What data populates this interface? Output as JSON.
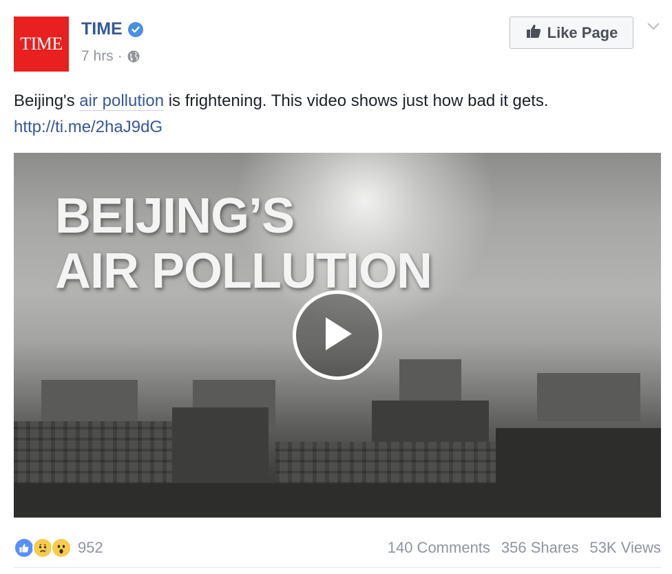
{
  "post": {
    "page_name": "TIME",
    "avatar_text": "TIME",
    "time_ago": "7 hrs",
    "separator": "·",
    "like_button_label": "Like Page",
    "caption": {
      "prefix": "Beijing's ",
      "link_text": "air pollution",
      "suffix": " is frightening. This video shows just how bad it gets.",
      "url": "http://ti.me/2haJ9dG"
    },
    "video": {
      "title_line1": "BEIJING’S",
      "title_line2": "AIR POLLUTION"
    },
    "footer": {
      "reaction_count": "952",
      "comments": "140 Comments",
      "shares": "356 Shares",
      "views": "53K Views"
    }
  },
  "icons": [
    "verified-badge-icon",
    "globe-icon",
    "thumbs-up-icon",
    "chevron-down-icon",
    "play-icon",
    "like-reaction-icon",
    "sad-reaction-icon",
    "wow-reaction-icon"
  ],
  "colors": {
    "brand_red": "#e8201f",
    "link_blue": "#365899",
    "meta_gray": "#90949c",
    "like_reaction": "#5890ff"
  }
}
